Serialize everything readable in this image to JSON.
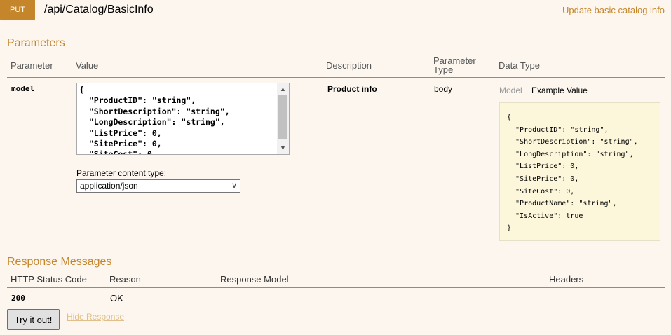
{
  "header": {
    "method": "PUT",
    "path": "/api/Catalog/BasicInfo",
    "summary": "Update basic catalog info"
  },
  "parameters": {
    "title": "Parameters",
    "columns": {
      "parameter": "Parameter",
      "value": "Value",
      "description": "Description",
      "parameter_type_line1": "Parameter",
      "parameter_type_line2": "Type",
      "data_type": "Data Type"
    },
    "row": {
      "name": "model",
      "value_text": "{\n  \"ProductID\": \"string\",\n  \"ShortDescription\": \"string\",\n  \"LongDescription\": \"string\",\n  \"ListPrice\": 0,\n  \"SitePrice\": 0,\n  \"SiteCost\": 0,",
      "content_type_label": "Parameter content type:",
      "content_type_selected": "application/json",
      "description": "Product info",
      "parameter_type": "body",
      "model_tab": "Model",
      "example_tab": "Example Value",
      "example_json": "{\n  \"ProductID\": \"string\",\n  \"ShortDescription\": \"string\",\n  \"LongDescription\": \"string\",\n  \"ListPrice\": 0,\n  \"SitePrice\": 0,\n  \"SiteCost\": 0,\n  \"ProductName\": \"string\",\n  \"IsActive\": true\n}"
    }
  },
  "responses": {
    "title": "Response Messages",
    "columns": {
      "status": "HTTP Status Code",
      "reason": "Reason",
      "model": "Response Model",
      "headers": "Headers"
    },
    "rows": [
      {
        "code": "200",
        "reason": "OK"
      }
    ]
  },
  "actions": {
    "try_label": "Try it out!",
    "hide_label": "Hide Response"
  },
  "icons": {
    "scroll_up": "scroll-up-arrow-icon",
    "scroll_down": "scroll-down-arrow-icon",
    "select": "chevron-down-icon"
  },
  "colors": {
    "accent": "#c5862b",
    "background": "#fcf6ef",
    "snippet_background": "#fcf6db"
  }
}
